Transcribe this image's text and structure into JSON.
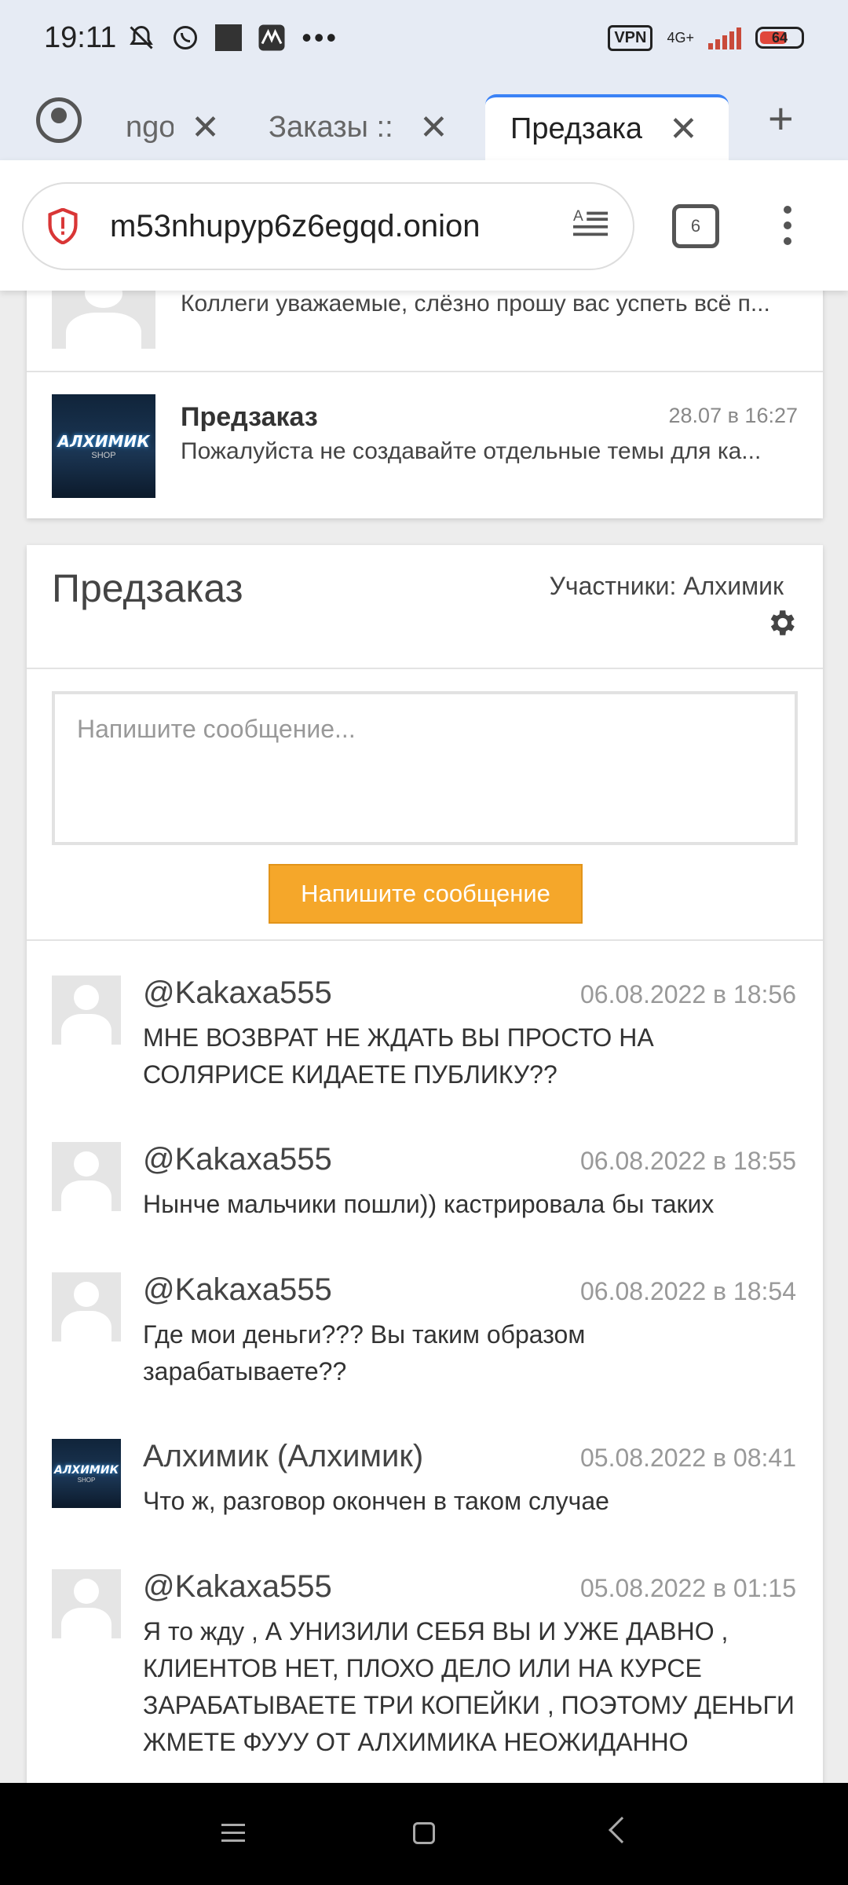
{
  "status_bar": {
    "time": "19:11",
    "vpn": "VPN",
    "network": "4G+",
    "battery": "64"
  },
  "tabs": [
    {
      "label": "ngo",
      "active": false
    },
    {
      "label": "Заказы ::",
      "active": false
    },
    {
      "label": "Предзака",
      "active": true
    }
  ],
  "address_bar": {
    "url": "m53nhupyp6z6egqd.onion",
    "tab_count": "6"
  },
  "thread_list": [
    {
      "title": "",
      "date": "",
      "preview": "Коллеги уважаемые, слёзно прошу вас успеть всё п...",
      "avatar": "default"
    },
    {
      "title": "Предзаказ",
      "date": "28.07 в 16:27",
      "preview": "Пожалуйста не создавайте отдельные темы для ка...",
      "avatar": "shop"
    }
  ],
  "chat": {
    "title": "Предзаказ",
    "members": "Участники: Алхимик",
    "placeholder": "Напишите сообщение...",
    "send_label": "Напишите сообщение"
  },
  "shop_logo": {
    "big": "АЛХИМИК",
    "small": "SHOP"
  },
  "messages": [
    {
      "author": "@Kakaxa555",
      "date": "06.08.2022 в 18:56",
      "text": "МНЕ ВОЗВРАТ НЕ ЖДАТЬ ВЫ ПРОСТО НА СОЛЯРИСЕ КИДАЕТЕ ПУБЛИКУ??",
      "avatar": "default"
    },
    {
      "author": "@Kakaxa555",
      "date": "06.08.2022 в 18:55",
      "text": "Нынче мальчики пошли)) кастрировала бы таких",
      "avatar": "default"
    },
    {
      "author": "@Kakaxa555",
      "date": "06.08.2022 в 18:54",
      "text": "Где мои деньги??? Вы таким образом зарабатываете??",
      "avatar": "default"
    },
    {
      "author": "Алхимик (Алхимик)",
      "date": "05.08.2022 в 08:41",
      "text": "Что ж, разговор окончен в таком случае",
      "avatar": "shop"
    },
    {
      "author": "@Kakaxa555",
      "date": "05.08.2022 в 01:15",
      "text": "Я то жду , А УНИЗИЛИ СЕБЯ ВЫ И УЖЕ ДАВНО , КЛИЕНТОВ НЕТ, ПЛОХО ДЕЛО ИЛИ НА КУРСЕ ЗАРАБАТЫВАЕТЕ ТРИ КОПЕЙКИ , ПОЭТОМУ ДЕНЬГИ ЖМЕТЕ ФУУУ ОТ АЛХИМИКА НЕОЖИДАННО",
      "avatar": "default"
    }
  ],
  "colors": {
    "accent": "#f5a72a",
    "tab_indicator": "#3b82f6",
    "shield": "#d93636"
  }
}
